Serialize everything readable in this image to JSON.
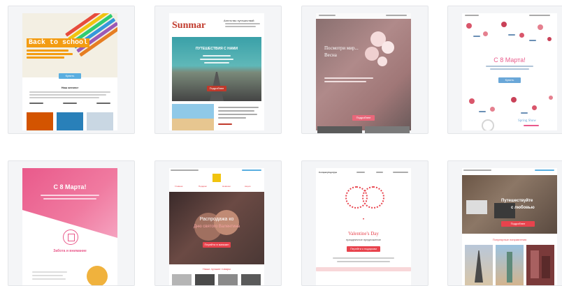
{
  "templates": [
    {
      "id": "back-to-school",
      "headline": "Back to school",
      "button": "Купить",
      "section_title": "Наш каталог"
    },
    {
      "id": "summar-travel",
      "brand": "Sunmar",
      "agency": "Агентство путешествий",
      "headline": "ПУТЕШЕСТВИЯ С НАМИ",
      "button": "Подробнее"
    },
    {
      "id": "spring",
      "headline_line1": "Посмотри мир...",
      "headline_line2": "Весна",
      "button": "Подробнее"
    },
    {
      "id": "march-8-floral",
      "headline": "С 8 Марта!",
      "button": "Купить",
      "footer": "Spring Show"
    },
    {
      "id": "march-8-pink",
      "headline": "С 8 Марта!",
      "subheading": "Забота и внимание"
    },
    {
      "id": "sale",
      "nav": [
        "Главная",
        "Подарки",
        "Новинки",
        "Акции"
      ],
      "headline_line1": "Распродажа ко",
      "headline_line2": "Дню святого Валентина",
      "button": "Перейти в магазин",
      "section_title": "Наши лучшие товары"
    },
    {
      "id": "valentines-day",
      "logo": "Companylogotype",
      "headline": "Valentine's Day",
      "subheading": "праздничное предложение",
      "button": "Перейти к подаркам"
    },
    {
      "id": "travel-love",
      "headline_line1": "Путешествуйте",
      "headline_line2": "с любовью",
      "button": "Подробнее",
      "section_title": "Популярные направления"
    }
  ],
  "colors": {
    "card_bg": "#f4f5f7",
    "blue_button": "#5aaee0",
    "red_button": "#e8434d",
    "pink": "#e95a8b"
  }
}
